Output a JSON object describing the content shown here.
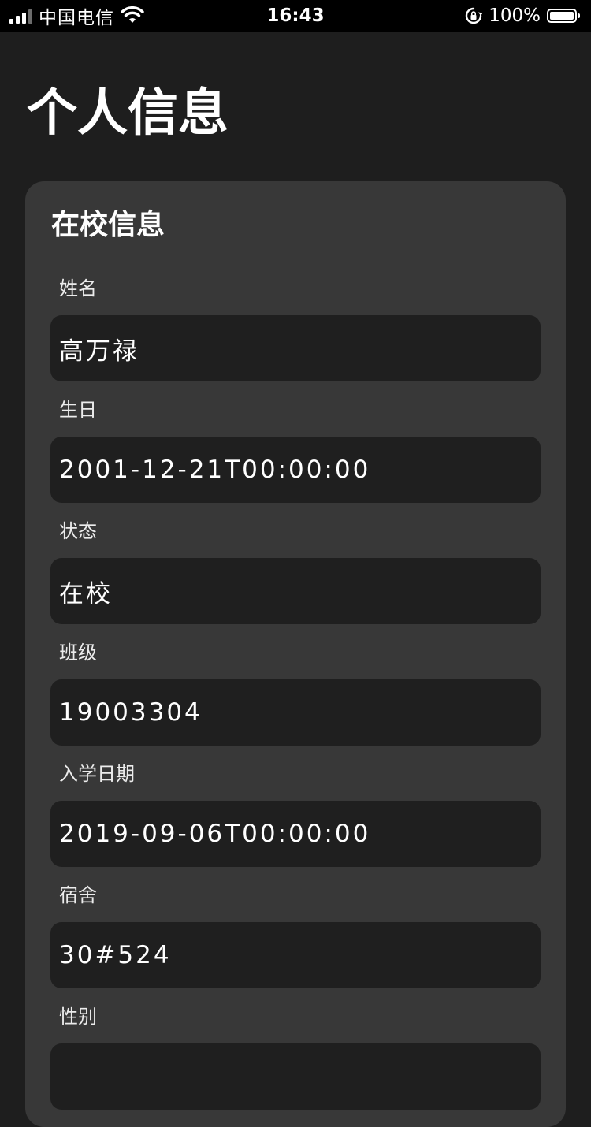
{
  "status_bar": {
    "carrier": "中国电信",
    "time": "16:43",
    "battery_percent": "100%",
    "signal_bars": 4,
    "signal_bars_active": 3,
    "icons": [
      "signal-icon",
      "wifi-icon",
      "rotation-lock-icon",
      "battery-icon"
    ]
  },
  "page": {
    "title": "个人信息"
  },
  "card": {
    "title": "在校信息",
    "fields": [
      {
        "label": "姓名",
        "value": "高万禄"
      },
      {
        "label": "生日",
        "value": "2001-12-21T00:00:00"
      },
      {
        "label": "状态",
        "value": "在校"
      },
      {
        "label": "班级",
        "value": "19003304"
      },
      {
        "label": "入学日期",
        "value": "2019-09-06T00:00:00"
      },
      {
        "label": "宿舍",
        "value": "30#524"
      },
      {
        "label": "性别",
        "value": ""
      }
    ]
  },
  "colors": {
    "background": "#1e1e1e",
    "status_bar": "#000000",
    "card": "#383838",
    "field_box": "#1f1f1f",
    "text": "#ffffff"
  }
}
